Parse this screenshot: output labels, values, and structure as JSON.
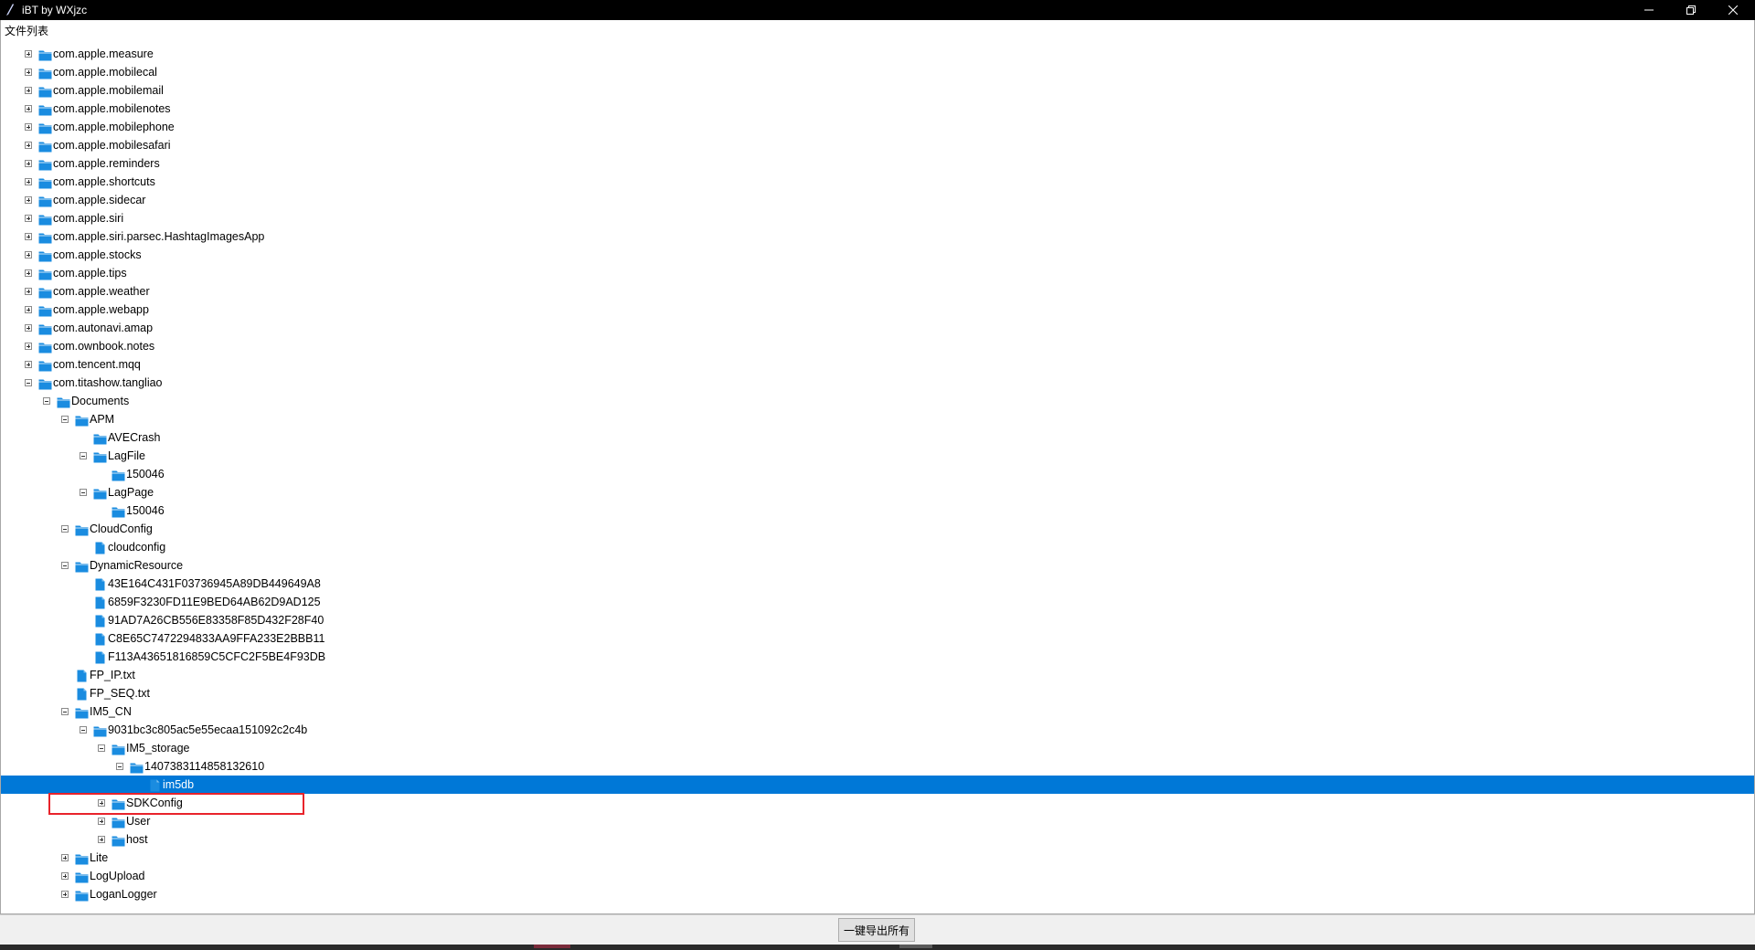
{
  "window": {
    "title": "iBT by WXjzc",
    "buttons": [
      "minimize-icon",
      "restore-icon",
      "close-icon"
    ]
  },
  "tree": {
    "header": "文件列表",
    "nodes": [
      {
        "label": "com.apple.measure",
        "depth": 0,
        "expander": "collapsed",
        "icon": "folder"
      },
      {
        "label": "com.apple.mobilecal",
        "depth": 0,
        "expander": "collapsed",
        "icon": "folder"
      },
      {
        "label": "com.apple.mobilemail",
        "depth": 0,
        "expander": "collapsed",
        "icon": "folder"
      },
      {
        "label": "com.apple.mobilenotes",
        "depth": 0,
        "expander": "collapsed",
        "icon": "folder"
      },
      {
        "label": "com.apple.mobilephone",
        "depth": 0,
        "expander": "collapsed",
        "icon": "folder"
      },
      {
        "label": "com.apple.mobilesafari",
        "depth": 0,
        "expander": "collapsed",
        "icon": "folder"
      },
      {
        "label": "com.apple.reminders",
        "depth": 0,
        "expander": "collapsed",
        "icon": "folder"
      },
      {
        "label": "com.apple.shortcuts",
        "depth": 0,
        "expander": "collapsed",
        "icon": "folder"
      },
      {
        "label": "com.apple.sidecar",
        "depth": 0,
        "expander": "collapsed",
        "icon": "folder"
      },
      {
        "label": "com.apple.siri",
        "depth": 0,
        "expander": "collapsed",
        "icon": "folder"
      },
      {
        "label": "com.apple.siri.parsec.HashtagImagesApp",
        "depth": 0,
        "expander": "collapsed",
        "icon": "folder"
      },
      {
        "label": "com.apple.stocks",
        "depth": 0,
        "expander": "collapsed",
        "icon": "folder"
      },
      {
        "label": "com.apple.tips",
        "depth": 0,
        "expander": "collapsed",
        "icon": "folder"
      },
      {
        "label": "com.apple.weather",
        "depth": 0,
        "expander": "collapsed",
        "icon": "folder"
      },
      {
        "label": "com.apple.webapp",
        "depth": 0,
        "expander": "collapsed",
        "icon": "folder"
      },
      {
        "label": "com.autonavi.amap",
        "depth": 0,
        "expander": "collapsed",
        "icon": "folder"
      },
      {
        "label": "com.ownbook.notes",
        "depth": 0,
        "expander": "collapsed",
        "icon": "folder"
      },
      {
        "label": "com.tencent.mqq",
        "depth": 0,
        "expander": "collapsed",
        "icon": "folder"
      },
      {
        "label": "com.titashow.tangliao",
        "depth": 0,
        "expander": "expanded",
        "icon": "folder"
      },
      {
        "label": "Documents",
        "depth": 1,
        "expander": "expanded",
        "icon": "folder"
      },
      {
        "label": "APM",
        "depth": 2,
        "expander": "expanded",
        "icon": "folder"
      },
      {
        "label": "AVECrash",
        "depth": 3,
        "expander": "none",
        "icon": "folder"
      },
      {
        "label": "LagFile",
        "depth": 3,
        "expander": "expanded",
        "icon": "folder"
      },
      {
        "label": "150046",
        "depth": 4,
        "expander": "none",
        "icon": "folder"
      },
      {
        "label": "LagPage",
        "depth": 3,
        "expander": "expanded",
        "icon": "folder"
      },
      {
        "label": "150046",
        "depth": 4,
        "expander": "none",
        "icon": "folder"
      },
      {
        "label": "CloudConfig",
        "depth": 2,
        "expander": "expanded",
        "icon": "folder"
      },
      {
        "label": "cloudconfig",
        "depth": 3,
        "expander": "none",
        "icon": "file"
      },
      {
        "label": "DynamicResource",
        "depth": 2,
        "expander": "expanded",
        "icon": "folder"
      },
      {
        "label": "43E164C431F03736945A89DB449649A8",
        "depth": 3,
        "expander": "none",
        "icon": "file"
      },
      {
        "label": "6859F3230FD11E9BED64AB62D9AD125",
        "depth": 3,
        "expander": "none",
        "icon": "file"
      },
      {
        "label": "91AD7A26CB556E83358F85D432F28F40",
        "depth": 3,
        "expander": "none",
        "icon": "file"
      },
      {
        "label": "C8E65C7472294833AA9FFA233E2BBB11",
        "depth": 3,
        "expander": "none",
        "icon": "file"
      },
      {
        "label": "F113A43651816859C5CFC2F5BE4F93DB",
        "depth": 3,
        "expander": "none",
        "icon": "file"
      },
      {
        "label": "FP_IP.txt",
        "depth": 2,
        "expander": "none",
        "icon": "file"
      },
      {
        "label": "FP_SEQ.txt",
        "depth": 2,
        "expander": "none",
        "icon": "file"
      },
      {
        "label": "IM5_CN",
        "depth": 2,
        "expander": "expanded",
        "icon": "folder"
      },
      {
        "label": "9031bc3c805ac5e55ecaa151092c2c4b",
        "depth": 3,
        "expander": "expanded",
        "icon": "folder"
      },
      {
        "label": "IM5_storage",
        "depth": 4,
        "expander": "expanded",
        "icon": "folder"
      },
      {
        "label": "1407383114858132610",
        "depth": 5,
        "expander": "expanded",
        "icon": "folder"
      },
      {
        "label": "im5db",
        "depth": 6,
        "expander": "none",
        "icon": "file",
        "selected": true
      },
      {
        "label": "SDKConfig",
        "depth": 4,
        "expander": "collapsed",
        "icon": "folder"
      },
      {
        "label": "User",
        "depth": 4,
        "expander": "collapsed",
        "icon": "folder"
      },
      {
        "label": "host",
        "depth": 4,
        "expander": "collapsed",
        "icon": "folder"
      },
      {
        "label": "Lite",
        "depth": 2,
        "expander": "collapsed",
        "icon": "folder"
      },
      {
        "label": "LogUpload",
        "depth": 2,
        "expander": "collapsed",
        "icon": "folder"
      },
      {
        "label": "LoganLogger",
        "depth": 2,
        "expander": "collapsed",
        "icon": "folder"
      }
    ]
  },
  "footer": {
    "export_all_label": "一键导出所有"
  },
  "colors": {
    "selection": "#0078d7",
    "folder_icon": "#1a8ce0",
    "file_icon": "#1a8ce0",
    "highlight_box": "#e8232b",
    "titlebar": "#000000"
  }
}
